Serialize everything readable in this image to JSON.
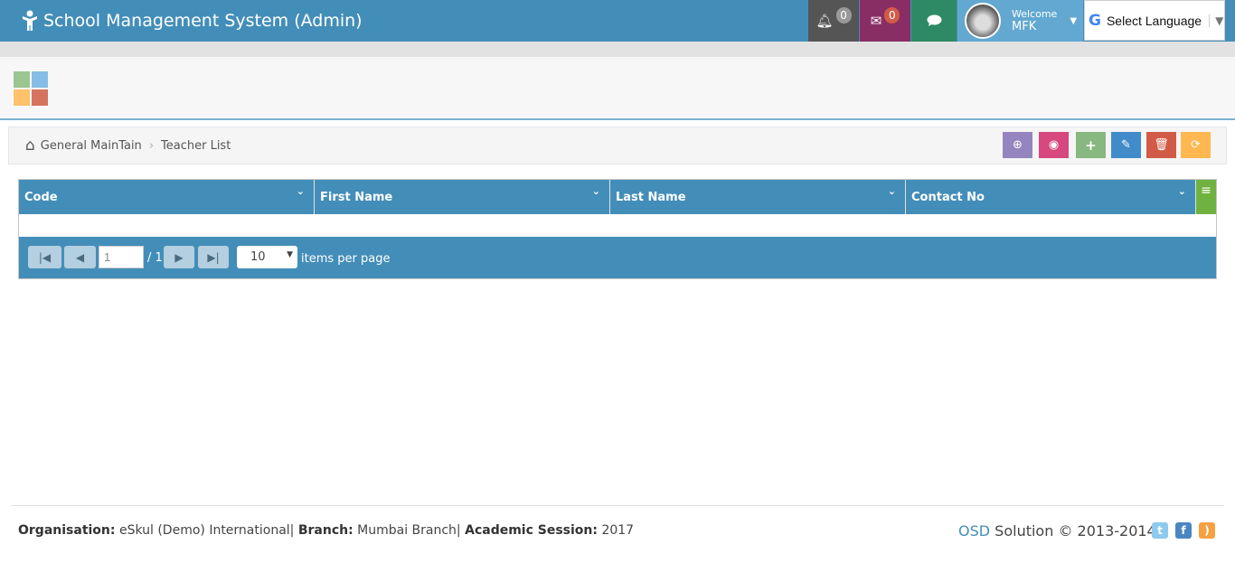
{
  "header": {
    "title": "School Management System (Admin)",
    "notifications_count": "0",
    "messages_count": "0",
    "welcome": "Welcome",
    "user": "MFK",
    "language": "Select Language"
  },
  "breadcrumb": {
    "items": [
      "General MainTain",
      "Teacher List"
    ]
  },
  "toolbar": {
    "buttons": [
      {
        "icon": "zoom-in-icon",
        "color": "#9585bf"
      },
      {
        "icon": "eye-icon",
        "color": "#d6487e"
      },
      {
        "icon": "plus-icon",
        "color": "#87b87f"
      },
      {
        "icon": "pencil-icon",
        "color": "#428bca"
      },
      {
        "icon": "trash-icon",
        "color": "#d15b47"
      },
      {
        "icon": "refresh-icon",
        "color": "#ffb752"
      }
    ]
  },
  "grid": {
    "columns": [
      "Code",
      "First Name",
      "Last Name",
      "Contact No"
    ],
    "rows": []
  },
  "pager": {
    "page": "1",
    "total_pages": "/ 1",
    "page_size": "10",
    "items_per_page": "items per page"
  },
  "footer": {
    "org_label": "Organisation:",
    "org": "eSkul (Demo) International|",
    "branch_label": "Branch:",
    "branch": "Mumbai Branch|",
    "session_label": "Academic Session:",
    "session": "2017",
    "brand": "OSD",
    "solution": "Solution © 2013-2014"
  },
  "colors": {
    "primary": "#438eb9",
    "notif": "#555555",
    "messages": "#892e65",
    "chat": "#2e8965",
    "user": "#62a8d1"
  }
}
